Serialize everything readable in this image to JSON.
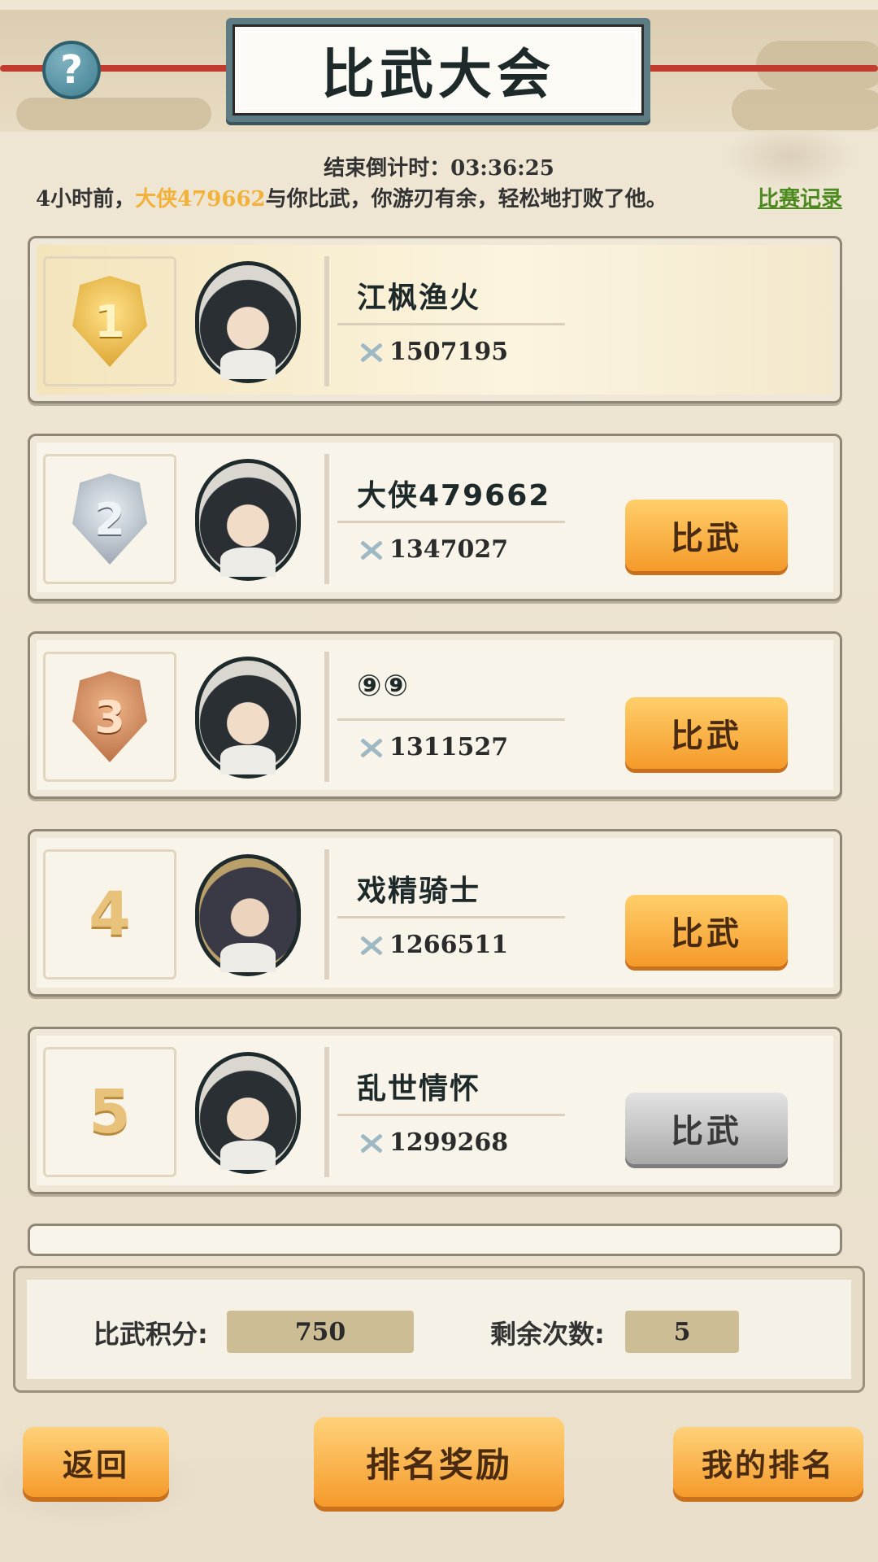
{
  "header": {
    "title": "比武大会",
    "help": "?"
  },
  "countdown": {
    "label": "结束倒计时：",
    "value": "03:36:25"
  },
  "message": {
    "prefix": "4小时前，",
    "opponent": "大侠479662",
    "suffix": "与你比武，你游刃有余，轻松地打败了他。",
    "record_link": "比赛记录"
  },
  "ranking": [
    {
      "rank": "1",
      "name": "江枫渔火",
      "power": "1507195",
      "medal": "gold"
    },
    {
      "rank": "2",
      "name": "大侠479662",
      "power": "1347027",
      "medal": "silver",
      "button": "比武"
    },
    {
      "rank": "3",
      "name": "⑨⑨",
      "power": "1311527",
      "medal": "bronze",
      "button": "比武"
    },
    {
      "rank": "4",
      "name": "戏精骑士",
      "power": "1266511",
      "button": "比武"
    },
    {
      "rank": "5",
      "name": "乱世情怀",
      "power": "1299268",
      "button": "比武",
      "button_disabled": true
    }
  ],
  "stats": {
    "points_label": "比武积分:",
    "points_value": "750",
    "remaining_label": "剩余次数:",
    "remaining_value": "5"
  },
  "footer": {
    "back": "返回",
    "rewards": "排名奖励",
    "my_rank": "我的排名"
  },
  "colors": {
    "accent_orange": "#f59a2a",
    "highlight_name": "#f2b23a",
    "link_green": "#4b8a1e",
    "disabled_gray": "#a9a9a9"
  }
}
